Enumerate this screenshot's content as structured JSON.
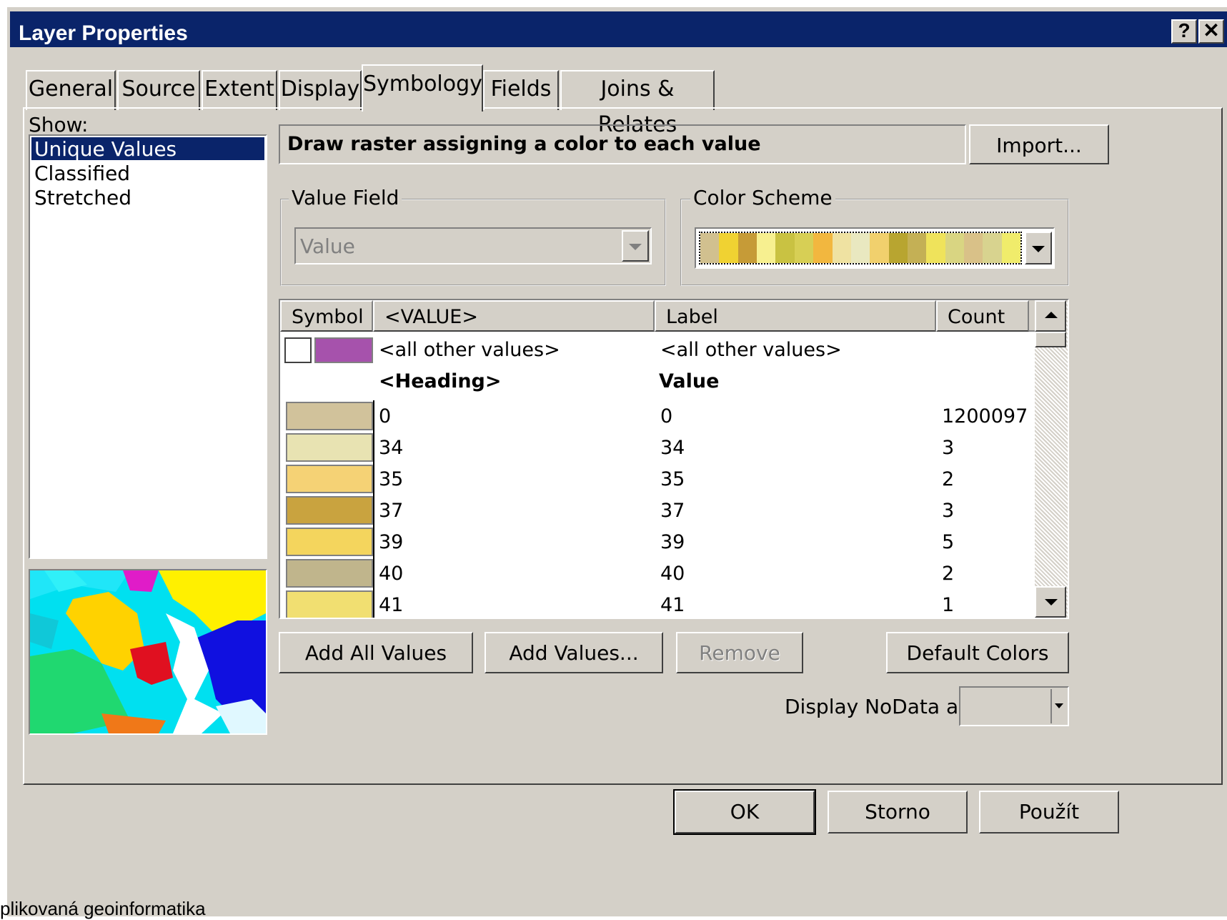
{
  "window": {
    "title": "Layer Properties",
    "help_label": "?",
    "close_label": "✕"
  },
  "tabs": [
    {
      "label": "General"
    },
    {
      "label": "Source"
    },
    {
      "label": "Extent"
    },
    {
      "label": "Display"
    },
    {
      "label": "Symbology",
      "active": true
    },
    {
      "label": "Fields"
    },
    {
      "label": "Joins & Relates"
    }
  ],
  "show": {
    "label": "Show:",
    "items": [
      {
        "label": "Unique Values",
        "selected": true
      },
      {
        "label": "Classified"
      },
      {
        "label": "Stretched"
      }
    ]
  },
  "description": "Draw raster assigning a color to each value",
  "import_button": "Import...",
  "value_field": {
    "legend": "Value Field",
    "value": "Value"
  },
  "color_scheme": {
    "legend": "Color Scheme",
    "colors": [
      "#d1c08f",
      "#f0d232",
      "#c69b37",
      "#f7f090",
      "#c9c242",
      "#d7cf55",
      "#f2b73f",
      "#efe2a2",
      "#e9e8c0",
      "#f1d06d",
      "#b8a530",
      "#c4b055",
      "#efe35b",
      "#d9d582",
      "#d9c188",
      "#d8d38f",
      "#f0ec6b"
    ]
  },
  "table": {
    "headers": {
      "symbol": "Symbol",
      "value": "<VALUE>",
      "label": "Label",
      "count": "Count"
    },
    "other": {
      "value": "<all other values>",
      "label": "<all other values>",
      "color": "#a652ac"
    },
    "heading": {
      "value": "<Heading>",
      "label": "Value"
    },
    "rows": [
      {
        "value": "0",
        "label": "0",
        "count": "1200097",
        "color": "#d1c29b"
      },
      {
        "value": "34",
        "label": "34",
        "count": "3",
        "color": "#e8e3b2"
      },
      {
        "value": "35",
        "label": "35",
        "count": "2",
        "color": "#f5d275"
      },
      {
        "value": "37",
        "label": "37",
        "count": "3",
        "color": "#c9a33f"
      },
      {
        "value": "39",
        "label": "39",
        "count": "5",
        "color": "#f4d55d"
      },
      {
        "value": "40",
        "label": "40",
        "count": "2",
        "color": "#c0b58c"
      },
      {
        "value": "41",
        "label": "41",
        "count": "1",
        "color": "#f1df71"
      }
    ]
  },
  "buttons": {
    "add_all": "Add All Values",
    "add_values": "Add Values...",
    "remove": "Remove",
    "default_colors": "Default Colors"
  },
  "nodata_label": "Display NoData as",
  "footer": {
    "ok": "OK",
    "cancel": "Storno",
    "apply": "Použít"
  },
  "bottom_text": "plikovaná geoinformatika"
}
